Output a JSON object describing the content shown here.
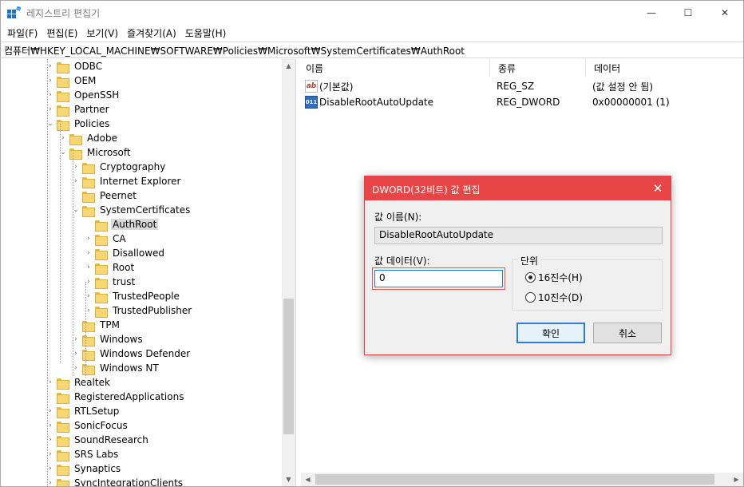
{
  "window": {
    "title": "레지스트리 편집기"
  },
  "window_controls": {
    "minimize": "—",
    "maximize": "☐",
    "close": "✕"
  },
  "menu": [
    "파일(F)",
    "편집(E)",
    "보기(V)",
    "즐겨찾기(A)",
    "도움말(H)"
  ],
  "address": "컴퓨터₩HKEY_LOCAL_MACHINE₩SOFTWARE₩Policies₩Microsoft₩SystemCertificates₩AuthRoot",
  "tree": [
    {
      "label": "ODBC",
      "expander": "›"
    },
    {
      "label": "OEM",
      "expander": "›"
    },
    {
      "label": "OpenSSH",
      "expander": "›"
    },
    {
      "label": "Partner",
      "expander": "›"
    },
    {
      "label": "Policies",
      "expander": "⌄"
    },
    {
      "label": "Adobe",
      "expander": "›"
    },
    {
      "label": "Microsoft",
      "expander": "⌄"
    },
    {
      "label": "Cryptography",
      "expander": "›"
    },
    {
      "label": "Internet Explorer",
      "expander": "›"
    },
    {
      "label": "Peernet",
      "expander": ""
    },
    {
      "label": "SystemCertificates",
      "expander": "⌄"
    },
    {
      "label": "AuthRoot",
      "expander": "",
      "selected": true
    },
    {
      "label": "CA",
      "expander": "›"
    },
    {
      "label": "Disallowed",
      "expander": "›"
    },
    {
      "label": "Root",
      "expander": "›"
    },
    {
      "label": "trust",
      "expander": "›"
    },
    {
      "label": "TrustedPeople",
      "expander": "›"
    },
    {
      "label": "TrustedPublisher",
      "expander": "›"
    },
    {
      "label": "TPM",
      "expander": ""
    },
    {
      "label": "Windows",
      "expander": "›"
    },
    {
      "label": "Windows Defender",
      "expander": "›"
    },
    {
      "label": "Windows NT",
      "expander": "›"
    },
    {
      "label": "Realtek",
      "expander": "›"
    },
    {
      "label": "RegisteredApplications",
      "expander": ""
    },
    {
      "label": "RTLSetup",
      "expander": "›"
    },
    {
      "label": "SonicFocus",
      "expander": "›"
    },
    {
      "label": "SoundResearch",
      "expander": "›"
    },
    {
      "label": "SRS Labs",
      "expander": "›"
    },
    {
      "label": "Synaptics",
      "expander": "›"
    },
    {
      "label": "SyncIntegrationClients",
      "expander": "›"
    }
  ],
  "list": {
    "columns": [
      "이름",
      "종류",
      "데이터"
    ],
    "rows": [
      {
        "icon": "string-value-icon",
        "icon_text": "ab",
        "name": "(기본값)",
        "type": "REG_SZ",
        "data": "(값 설정 안 됨)"
      },
      {
        "icon": "binary-value-icon",
        "icon_text": "011",
        "name": "DisableRootAutoUpdate",
        "type": "REG_DWORD",
        "data": "0x00000001 (1)"
      }
    ]
  },
  "dialog": {
    "title": "DWORD(32비트) 값 편집",
    "name_label": "값 이름(N):",
    "name_value": "DisableRootAutoUpdate",
    "data_label": "값 데이터(V):",
    "data_value": "0",
    "base_label": "단위",
    "radio_hex": "16진수(H)",
    "radio_dec": "10진수(D)",
    "selected_base": "hex",
    "ok": "확인",
    "cancel": "취소"
  },
  "colors": {
    "dialog_accent": "#e84646",
    "focus_blue": "#1f7be0",
    "folder": "#f7d774"
  }
}
